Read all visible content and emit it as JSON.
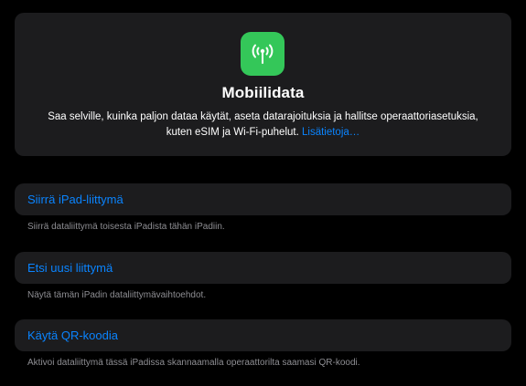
{
  "hero": {
    "icon": "antenna-radiowaves-icon",
    "icon_color": "#34c759",
    "title": "Mobiilidata",
    "description_line1": "Saa selville, kuinka paljon dataa käytät, aseta datarajoituksia ja hallitse operaattoriasetuksia,",
    "description_line2": "kuten eSIM ja Wi-Fi-puhelut.",
    "link_label": "Lisätietoja…"
  },
  "options": [
    {
      "label": "Siirrä iPad-liittymä",
      "footer": "Siirrä dataliittymä toisesta iPadista tähän iPadiin."
    },
    {
      "label": "Etsi uusi liittymä",
      "footer": "Näytä tämän iPadin dataliittymävaihtoehdot."
    },
    {
      "label": "Käytä QR-koodia",
      "footer": "Aktivoi dataliittymä tässä iPadissa skannaamalla operaattorilta saamasi QR-koodi."
    }
  ],
  "colors": {
    "accent": "#0a84ff",
    "card_background": "#1c1c1e",
    "secondary_text": "#8e8e93"
  }
}
